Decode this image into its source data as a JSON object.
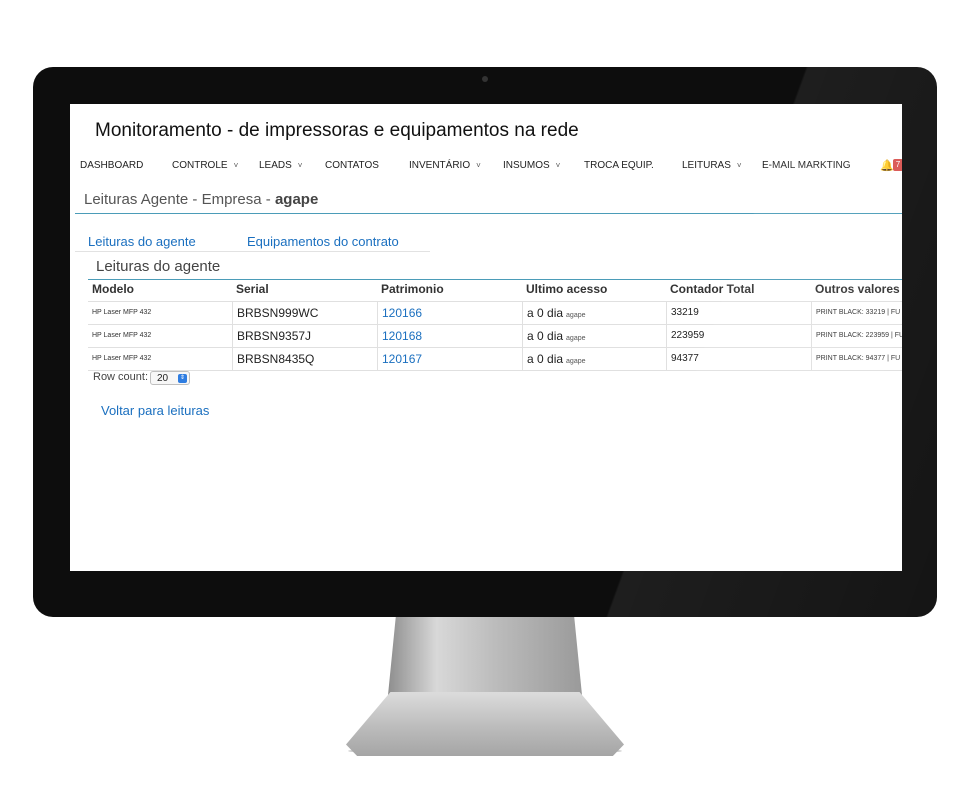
{
  "app": {
    "title": "Monitoramento - de impressoras e equipamentos na rede"
  },
  "nav": {
    "items": [
      {
        "label": "DASHBOARD"
      },
      {
        "label": "CONTROLE",
        "chevron": "˅"
      },
      {
        "label": "LEADS",
        "chevron": "˅"
      },
      {
        "label": "CONTATOS"
      },
      {
        "label": "INVENTÁRIO",
        "chevron": "˅"
      },
      {
        "label": "INSUMOS",
        "chevron": "˅"
      },
      {
        "label": "TROCA EQUIP."
      },
      {
        "label": "LEITURAS",
        "chevron": "˅"
      },
      {
        "label": "E-MAIL MARKTING"
      }
    ],
    "notifications_icon": "bell-icon",
    "badge": "7"
  },
  "page": {
    "header_prefix": "Leituras Agente - Empresa - ",
    "company": "agape",
    "tabs": [
      "Leituras do agente",
      "Equipamentos do contrato"
    ],
    "section_title": "Leituras do agente"
  },
  "table": {
    "columns": [
      "Modelo",
      "Serial",
      "Patrimonio",
      "Ultimo acesso",
      "Contador Total",
      "Outros valores"
    ],
    "rows": [
      {
        "modelo": "HP Laser MFP 432",
        "serial": "BRBSN999WC",
        "patrimonio": "120166",
        "ultimo": "a 0 dia",
        "ultimo_tag": "agape",
        "contador": "33219",
        "outros": "PRINT BLACK: 33219 | FU"
      },
      {
        "modelo": "HP Laser MFP 432",
        "serial": "BRBSN9357J",
        "patrimonio": "120168",
        "ultimo": "a 0 dia",
        "ultimo_tag": "agape",
        "contador": "223959",
        "outros": "PRINT BLACK: 223959 | FU"
      },
      {
        "modelo": "HP Laser MFP 432",
        "serial": "BRBSN8435Q",
        "patrimonio": "120167",
        "ultimo": "a 0 dia",
        "ultimo_tag": "agape",
        "contador": "94377",
        "outros": "PRINT BLACK: 94377 | FU"
      }
    ]
  },
  "footer": {
    "row_count_label": "Row count:",
    "row_count_value": "20",
    "back_link": "Voltar para leituras"
  },
  "colors": {
    "accent": "#1a6fbf",
    "rule": "#4b9cb8",
    "badge": "#d9534f"
  }
}
